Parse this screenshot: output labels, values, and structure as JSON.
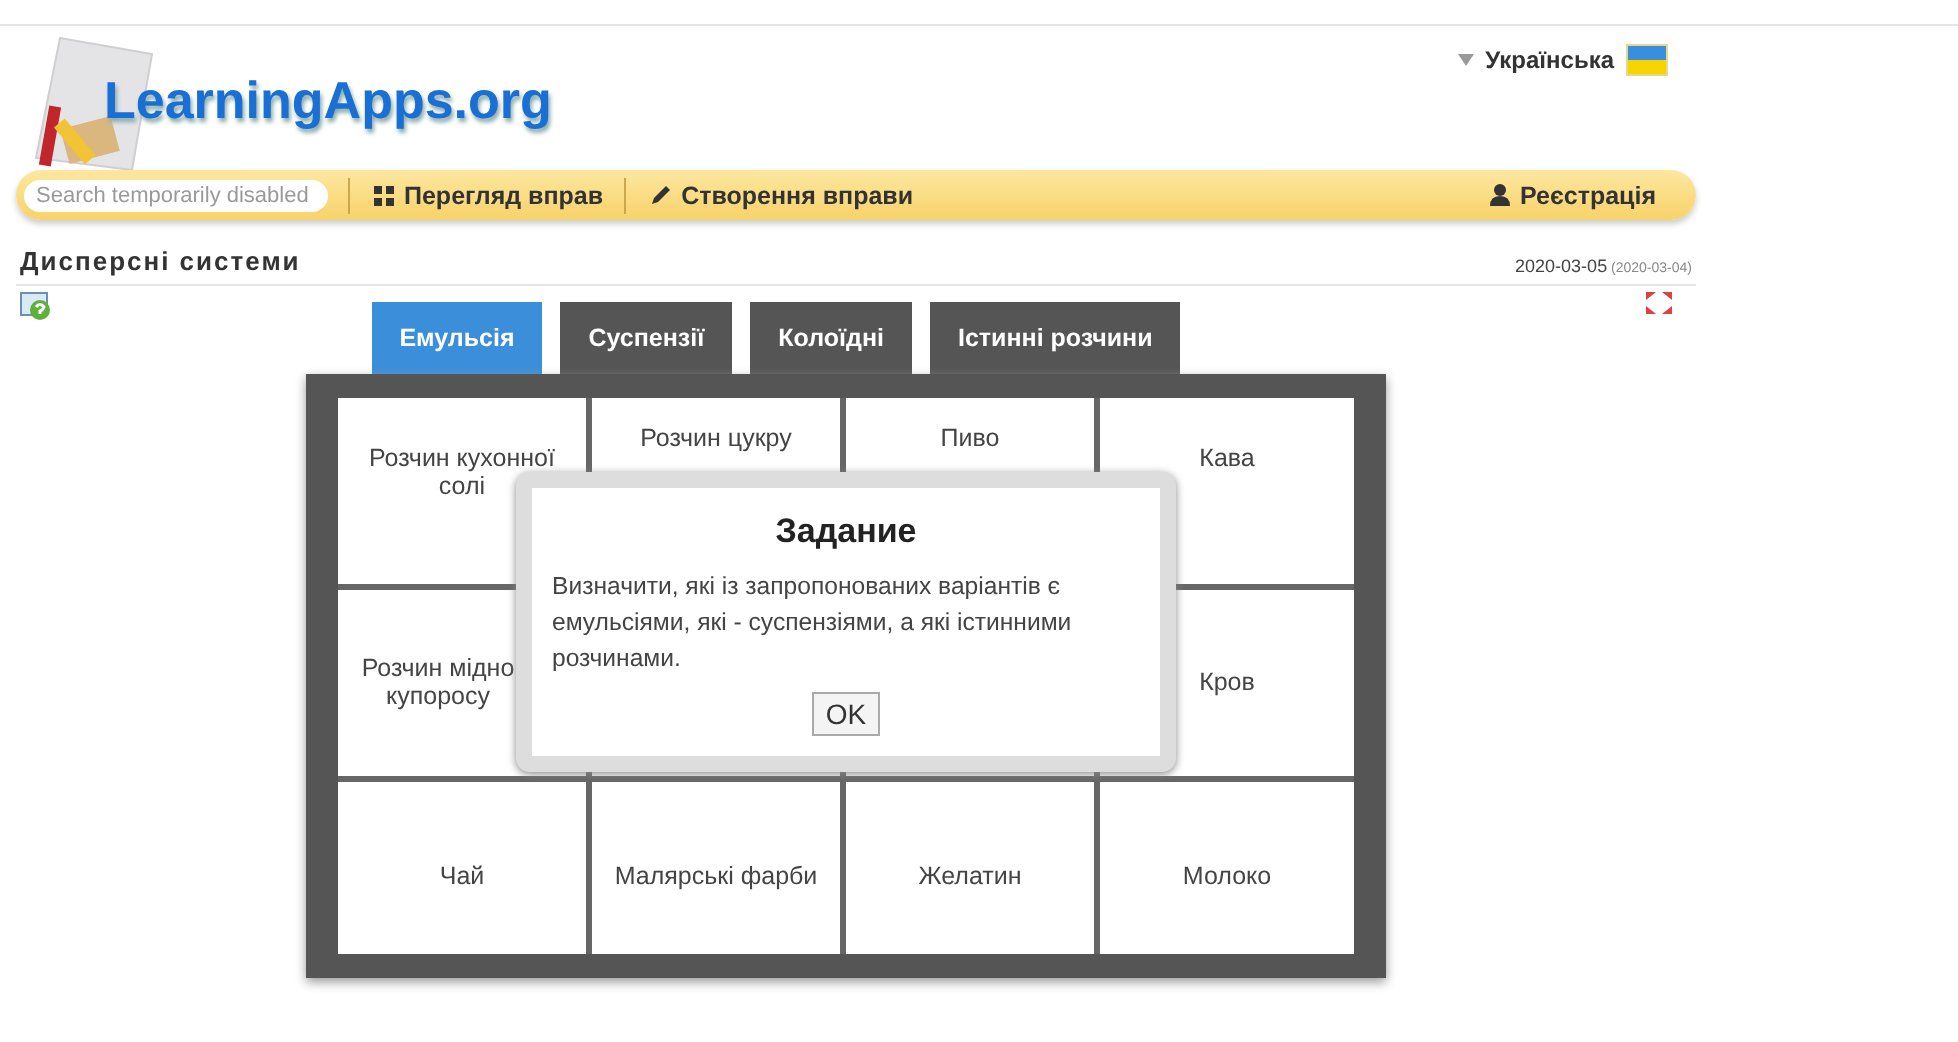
{
  "header": {
    "logo": "LearningApps.org",
    "language": "Українська"
  },
  "nav": {
    "search_placeholder": "Search temporarily disabled",
    "items": [
      {
        "label": "Перегляд вправ",
        "kind": "grid"
      },
      {
        "label": "Створення вправи",
        "kind": "pencil"
      }
    ],
    "register": "Реєстрація"
  },
  "app": {
    "title": "Дисперсні системи",
    "date": "2020-03-05",
    "date_original": "(2020-03-04)"
  },
  "tabs": [
    {
      "label": "Емульсія",
      "selected": true
    },
    {
      "label": "Суспензії",
      "selected": false
    },
    {
      "label": "Колоїдні",
      "selected": false
    },
    {
      "label": "Істинні розчини",
      "selected": false
    }
  ],
  "pieces": [
    {
      "kind": "text",
      "label": "Розчин кухонної солі"
    },
    {
      "kind": "text",
      "label": "Розчин цукру"
    },
    {
      "kind": "text",
      "label": "Пиво"
    },
    {
      "kind": "text",
      "label": "Кава"
    },
    {
      "kind": "text",
      "label": "Розчин мідно купоросу"
    },
    {
      "kind": "covered"
    },
    {
      "kind": "covered"
    },
    {
      "kind": "text",
      "label": "Кров"
    },
    {
      "kind": "text",
      "label": "Чай"
    },
    {
      "kind": "text",
      "label": "Малярські фарби"
    },
    {
      "kind": "text",
      "label": "Желатин"
    },
    {
      "kind": "text",
      "label": "Молоко"
    }
  ],
  "dialog": {
    "title": "Задание",
    "text": "Визначити, які із запропонованих варіантів є емульсіями, які - суспензіями, а які істинними розчинами.",
    "button": "OK"
  }
}
